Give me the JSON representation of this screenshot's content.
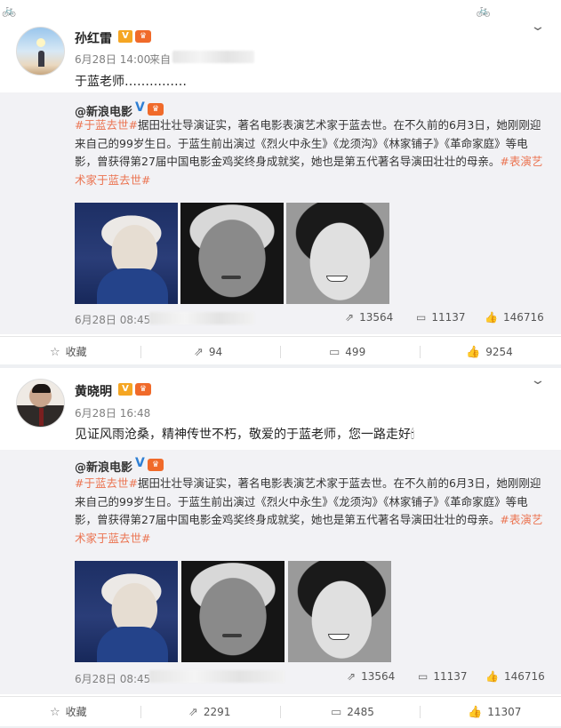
{
  "deco_glyphs": "🚲",
  "posts": [
    {
      "author": "孙红雷",
      "verified_badge": "V",
      "level_badge": "♛",
      "time": "6月28日 14:00",
      "source_label": "来自",
      "text": "于蓝老师……………",
      "repost": {
        "author": "@新浪电影",
        "tag_start": "#于蓝去世#",
        "body": "据田壮壮导演证实，著名电影表演艺术家于蓝去世。在不久前的6月3日，她刚刚迎来自己的99岁生日。于蓝生前出演过《烈火中永生》《龙须沟》《林家铺子》《革命家庭》等电影，曾获得第27届中国电影金鸡奖终身成就奖，她也是第五代著名导演田壮壮的母亲。",
        "tag_end": "#表演艺术家于蓝去世#",
        "time": "6月28日 08:45",
        "reposts": "13564",
        "comments": "11137",
        "likes": "146716"
      },
      "actions": {
        "fav": "收藏",
        "repost": "94",
        "comment": "499",
        "like": "9254"
      }
    },
    {
      "author": "黄晓明",
      "verified_badge": "V",
      "level_badge": "♛",
      "time": "6月28日 16:48",
      "text": "见证风雨沧桑，精神传世不朽，敬爱的于蓝老师，您一路走好🕯",
      "repost": {
        "author": "@新浪电影",
        "tag_start": "#于蓝去世#",
        "body": "据田壮壮导演证实，著名电影表演艺术家于蓝去世。在不久前的6月3日，她刚刚迎来自己的99岁生日。于蓝生前出演过《烈火中永生》《龙须沟》《林家铺子》《革命家庭》等电影，曾获得第27届中国电影金鸡奖终身成就奖，她也是第五代著名导演田壮壮的母亲。",
        "tag_end": "#表演艺术家于蓝去世#",
        "time": "6月28日 08:45",
        "reposts": "13564",
        "comments": "11137",
        "likes": "146716"
      },
      "actions": {
        "fav": "收藏",
        "repost": "2291",
        "comment": "2485",
        "like": "11307"
      }
    }
  ],
  "icons": {
    "repost": "⇗",
    "comment": "▭",
    "like": "👍",
    "fav": "☆",
    "chevron": "⌄"
  }
}
